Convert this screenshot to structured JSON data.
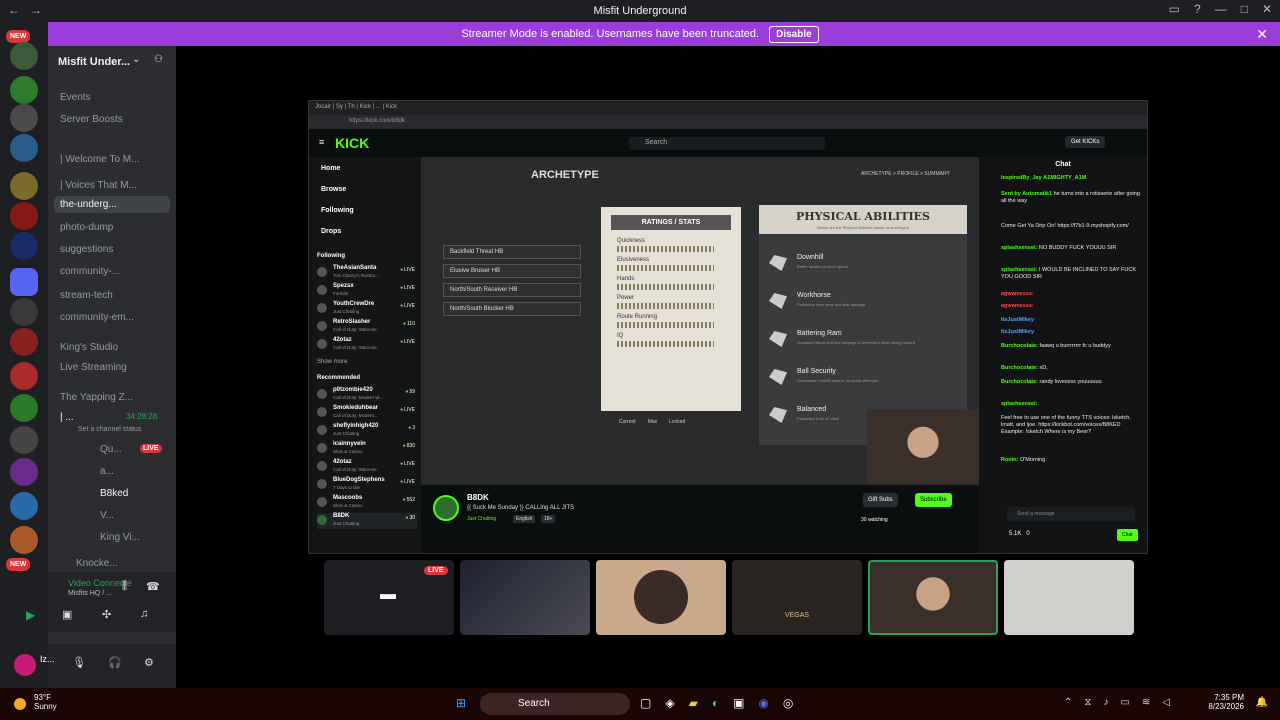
{
  "window": {
    "title": "Misfit Underground"
  },
  "banner": {
    "text": "Streamer Mode is enabled. Usernames have been truncated.",
    "button": "Disable"
  },
  "servers": {
    "new_badge": "NEW"
  },
  "sidebar": {
    "guild_name": "Misfit Under...",
    "items": [
      {
        "label": "Events",
        "active": false
      },
      {
        "label": "Server Boosts",
        "active": false
      },
      {
        "label": "| Welcome To M...",
        "active": false
      },
      {
        "label": "| Voices That M...",
        "active": false
      },
      {
        "label": "the-underg...",
        "active": true
      },
      {
        "label": "photo-dump",
        "active": false
      },
      {
        "label": "suggestions",
        "active": false
      },
      {
        "label": "community-...",
        "active": false
      },
      {
        "label": "stream-tech",
        "active": false
      },
      {
        "label": "community-em...",
        "active": false
      },
      {
        "label": "King's Studio",
        "active": false
      },
      {
        "label": "Live Streaming",
        "active": false
      },
      {
        "label": "The Yapping Z...",
        "active": false
      },
      {
        "label": "| ...",
        "active": false
      },
      {
        "label": "Set a channel status",
        "active": false
      },
      {
        "label": "Qu...",
        "active": false
      },
      {
        "label": "a...",
        "active": false
      },
      {
        "label": "B8ked",
        "active": false
      },
      {
        "label": "V...",
        "active": false
      },
      {
        "label": "King Vi...",
        "active": false
      },
      {
        "label": "Knocke...",
        "active": false
      }
    ],
    "voice_time": "34:28:28",
    "live_label": "LIVE",
    "voice_status": "Video Connecte",
    "voice_channel": "Misfits HQ / ...",
    "user_name": "Iz..."
  },
  "kick": {
    "tab_text": "Jocair | Sy | Th | Kick | ... | Kick",
    "url": "https://kick.com/b8dk",
    "logo": "KICK",
    "search_placeholder": "Search",
    "get_kicks": "Get KICKs",
    "nav": [
      "Home",
      "Browse",
      "Following",
      "Drops"
    ],
    "following_label": "Following",
    "show_more": "Show more",
    "recommended_label": "Recommended",
    "following": [
      {
        "name": "TheAsianSanta",
        "game": "Tom Clancy's Rainbo...",
        "viewers": "LIVE"
      },
      {
        "name": "Spezsx",
        "game": "Fortnite",
        "viewers": "LIVE"
      },
      {
        "name": "YouthCrewDre",
        "game": "Just Chatting",
        "viewers": "LIVE"
      },
      {
        "name": "RetroSlasher",
        "game": "Call of Duty: Warzone",
        "viewers": "110"
      },
      {
        "name": "42otaz",
        "game": "Call of Duty: Warzone",
        "viewers": "LIVE"
      }
    ],
    "recommended": [
      {
        "name": "p0tzombie420",
        "game": "Call of Duty: Modern W...",
        "viewers": "59"
      },
      {
        "name": "Smokieduhbear",
        "game": "Call of Duty: Modern...",
        "viewers": "LIVE"
      },
      {
        "name": "sheflyinhigh420",
        "game": "Just Chatting",
        "viewers": "3"
      },
      {
        "name": "icainnyvein",
        "game": "Slots & Casino",
        "viewers": "830"
      },
      {
        "name": "42otaz",
        "game": "Call of Duty: Warzone",
        "viewers": "LIVE"
      },
      {
        "name": "BlueDogStephens",
        "game": "7 Days to Die",
        "viewers": "LIVE"
      },
      {
        "name": "Mascoobs",
        "game": "Slots & Casino",
        "viewers": "552"
      },
      {
        "name": "B8DK",
        "game": "Just Chatting",
        "viewers": "30"
      }
    ],
    "video": {
      "header": "ARCHETYPE",
      "nav": "ARCHETYPE  >  PROFILE  >  SUMMARY",
      "archetypes": [
        "Backfield Threat HB",
        "Elusive Bruiser HB",
        "North/South Receiver HB",
        "North/South Blocker HB"
      ],
      "stats_title": "RATINGS / STATS",
      "stats": [
        {
          "name": "Quickness",
          "level": 0.9
        },
        {
          "name": "Elusiveness",
          "level": 0.9
        },
        {
          "name": "Hands",
          "level": 0.9
        },
        {
          "name": "Power",
          "level": 0.9
        },
        {
          "name": "Route Running",
          "level": 0.9
        },
        {
          "name": "IQ",
          "level": 0.9
        }
      ],
      "phys_title": "PHYSICAL ABILITIES",
      "phys_sub": "Below are the Physical Abilities based on Archetype",
      "abilities": [
        {
          "name": "Downhill",
          "desc": "Better tackles at more speed"
        },
        {
          "name": "Workhorse",
          "desc": "Protection from wear and tear damage"
        },
        {
          "name": "Battering Ram",
          "desc": "Increased Wear and tear damage to defenders when being tackled"
        },
        {
          "name": "Ball Security",
          "desc": "Decreases Fumble chance on tackle attempts"
        },
        {
          "name": "Balanced",
          "desc": "Protection from hit stick"
        }
      ],
      "legend": [
        "Current",
        "Max",
        "Locked"
      ]
    },
    "stream": {
      "name": "B8DK",
      "title": "{{ Suck Me Sunday }} CALLing ALL JITS",
      "category": "Just Chatting",
      "tags": [
        "English",
        "18+"
      ],
      "gift": "Gift Subs",
      "subscribe": "Subscribe",
      "watching": "30 watching"
    },
    "chat": {
      "title": "Chat",
      "pinned": "InspiredBy_Jay",
      "pinned2": "A1MIGHTY_A1M",
      "messages": [
        {
          "user": "Sent by Automatik1",
          "text": "he turns into a rotisserie after going all the way",
          "red": false
        },
        {
          "user": "",
          "text": "Come Get Ya Drip On! https://f7b1-9.myshopify.com/",
          "red": true
        },
        {
          "user": "splashsensei:",
          "text": "NO BUDDY FUCK YOUUU SIR",
          "red": false
        },
        {
          "user": "splashsensei:",
          "text": "I WOULD BE INCLINED TO SAY FUCK YOU GOOD SIR",
          "red": false
        },
        {
          "user": "agwamesss:",
          "text": "",
          "red": true
        },
        {
          "user": "agwamesss:",
          "text": "",
          "red": true
        },
        {
          "user": "ItsJustMikey",
          "text": "",
          "red": false
        },
        {
          "user": "ItsJustMikey",
          "text": "",
          "red": false
        },
        {
          "user": "Burchocolate:",
          "text": "faawq u burrrrrrrr fc u buddyy",
          "red": false
        },
        {
          "user": "Burchocolate:",
          "text": "xD,",
          "red": false
        },
        {
          "user": "Burchocolate:",
          "text": "randy lovessss youuuuuu",
          "red": false
        },
        {
          "user": "splashsensei:",
          "text": "",
          "red": false
        },
        {
          "user": "",
          "text": "Feel free to use one of the funny TTS voices: lsketch, lmatt, and ljoe. https://kickbot.com/voices/B8KED Example: !sketch Where is my Beer?",
          "red": true
        },
        {
          "user": "Ronin:",
          "text": "O'Morning",
          "red": false
        }
      ],
      "input_placeholder": "Send a message",
      "kicks": "5.1K",
      "points": "0",
      "send": "Chat"
    }
  },
  "call_tiles": {
    "live_label": "LIVE",
    "tile_label": "VEGAS"
  },
  "taskbar": {
    "temp": "93°F",
    "weather": "Sunny",
    "search": "Search",
    "time": "7:35 PM",
    "date": "8/23/2026"
  }
}
